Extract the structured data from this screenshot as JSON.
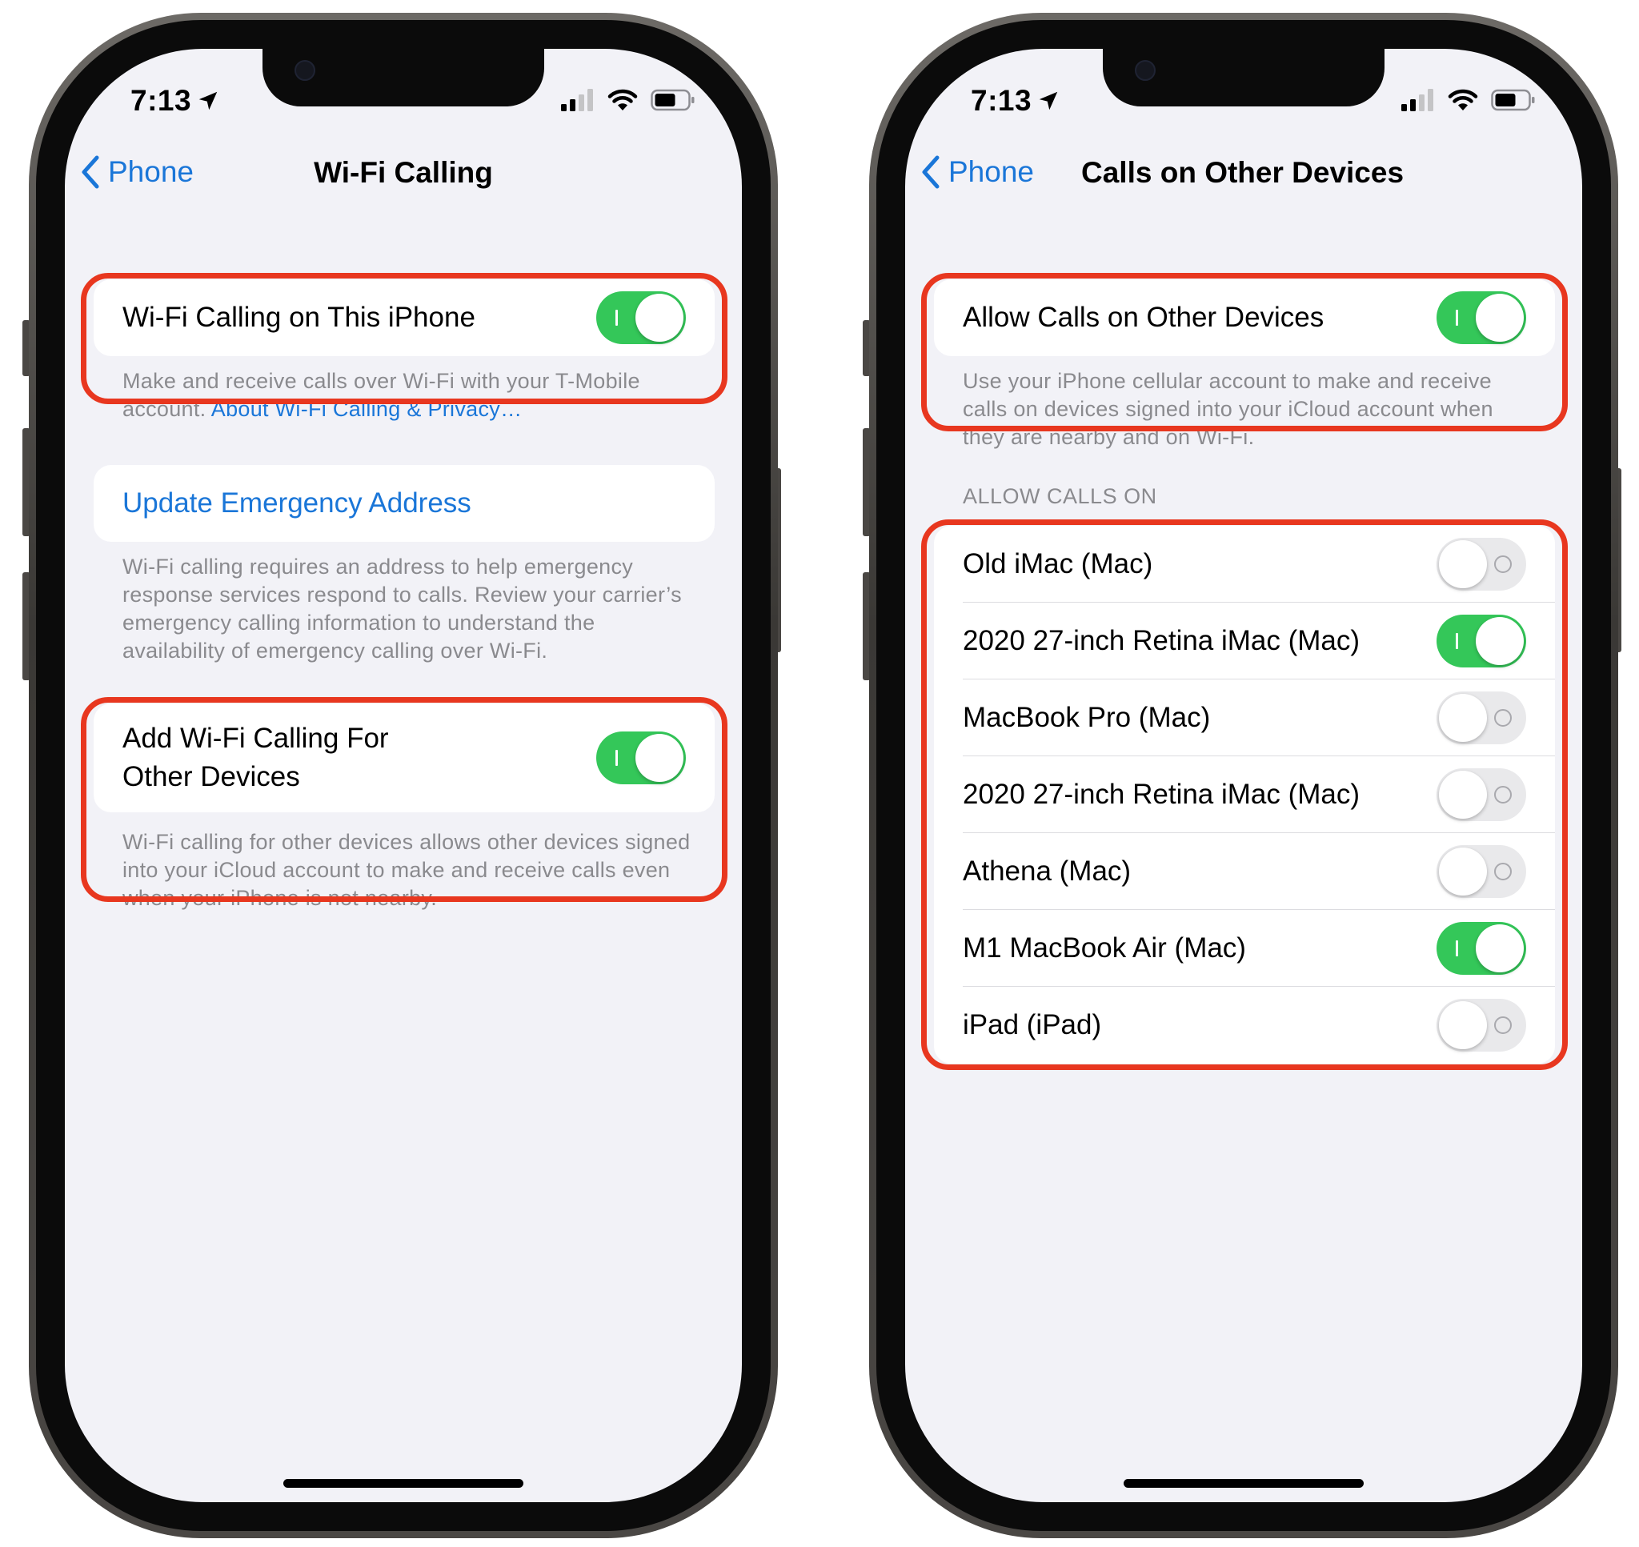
{
  "left_phone": {
    "status": {
      "time": "7:13"
    },
    "nav": {
      "back_label": "Phone",
      "title": "Wi-Fi Calling"
    },
    "wifi_calling_row": {
      "label": "Wi-Fi Calling on This iPhone",
      "on": true
    },
    "wifi_calling_footer": {
      "text": "Make and receive calls over Wi-Fi with your T-Mobile account.",
      "link": "About Wi-Fi Calling & Privacy…"
    },
    "emergency_row": {
      "label": "Update Emergency Address"
    },
    "emergency_footer": "Wi-Fi calling requires an address to help emergency response services respond to calls. Review your carrier’s emergency calling information to understand the availability of emergency calling over Wi-Fi.",
    "other_devices_row": {
      "label_line1": "Add Wi-Fi Calling For",
      "label_line2": "Other Devices",
      "on": true
    },
    "other_devices_footer": "Wi-Fi calling for other devices allows other devices signed into your iCloud account to make and receive calls even when your iPhone is not nearby."
  },
  "right_phone": {
    "status": {
      "time": "7:13"
    },
    "nav": {
      "back_label": "Phone",
      "title": "Calls on Other Devices"
    },
    "allow_row": {
      "label": "Allow Calls on Other Devices",
      "on": true
    },
    "allow_footer": "Use your iPhone cellular account to make and receive calls on devices signed into your iCloud account when they are nearby and on Wi-Fi.",
    "section_header": "ALLOW CALLS ON",
    "devices": [
      {
        "label": "Old iMac (Mac)",
        "on": false
      },
      {
        "label": "2020 27-inch Retina iMac (Mac)",
        "on": true
      },
      {
        "label": "MacBook Pro (Mac)",
        "on": false
      },
      {
        "label": "2020 27-inch Retina iMac (Mac)",
        "on": false
      },
      {
        "label": "Athena (Mac)",
        "on": false
      },
      {
        "label": "M1 MacBook Air (Mac)",
        "on": true
      },
      {
        "label": "iPad (iPad)",
        "on": false
      }
    ]
  },
  "icons": {
    "location": "location-arrow-icon",
    "signal": "cellular-signal-icon",
    "wifi": "wifi-icon",
    "battery": "battery-icon",
    "back": "chevron-left-icon"
  },
  "colors": {
    "accent": "#1a76d8",
    "toggle_on": "#34c759",
    "toggle_off": "#e9e9eb",
    "highlight": "#e8371f",
    "background": "#f2f2f7"
  }
}
